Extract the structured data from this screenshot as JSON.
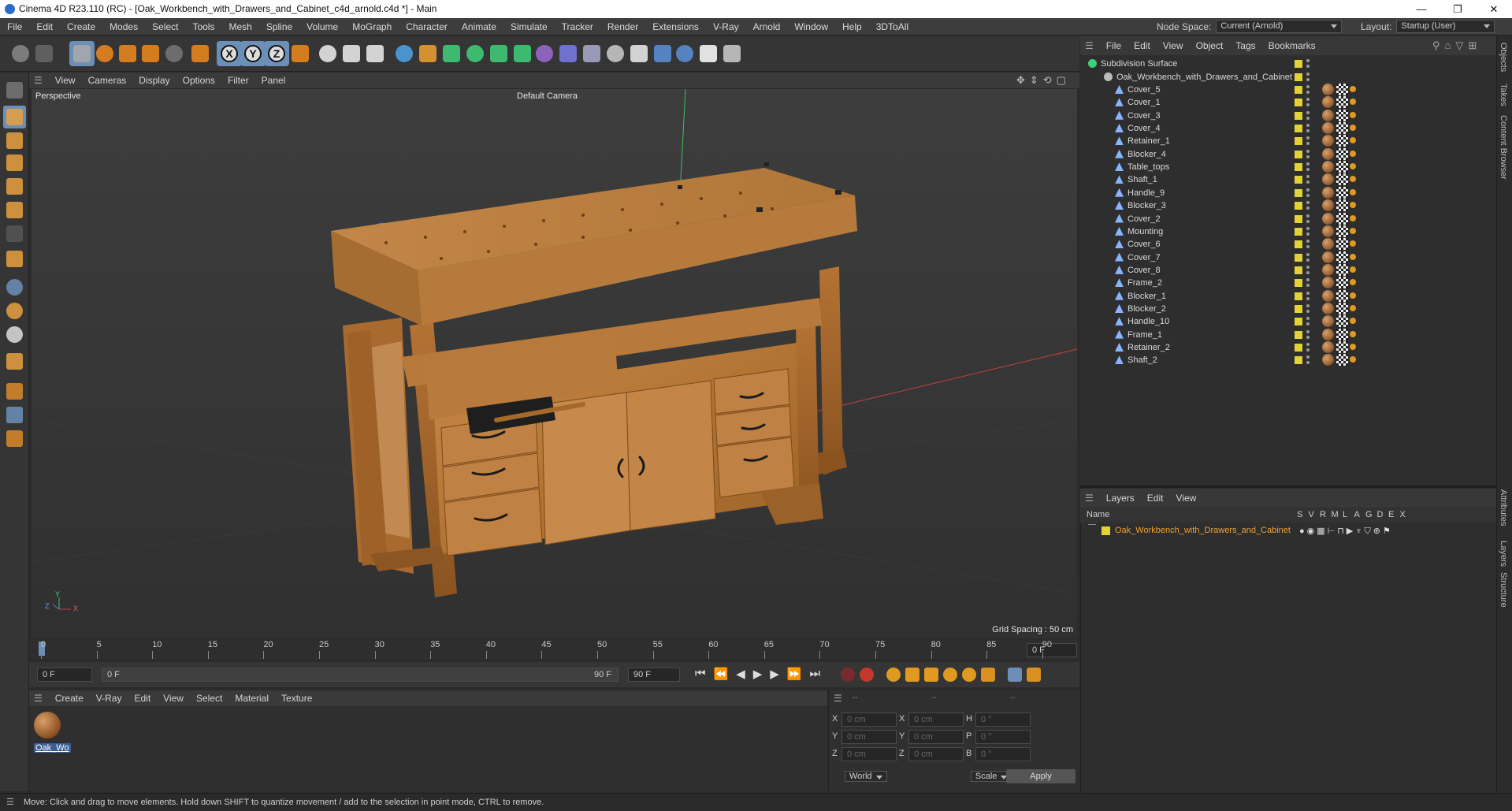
{
  "window": {
    "title": "Cinema 4D R23.110 (RC) - [Oak_Workbench_with_Drawers_and_Cabinet_c4d_arnold.c4d *] - Main",
    "controls": [
      "—",
      "❐",
      "✕"
    ]
  },
  "menubar": {
    "items": [
      "File",
      "Edit",
      "Create",
      "Modes",
      "Select",
      "Tools",
      "Mesh",
      "Spline",
      "Volume",
      "MoGraph",
      "Character",
      "Animate",
      "Simulate",
      "Tracker",
      "Render",
      "Extensions",
      "V-Ray",
      "Arnold",
      "Window",
      "Help",
      "3DToAll"
    ],
    "node_space_label": "Node Space:",
    "node_space_value": "Current (Arnold)",
    "layout_label": "Layout:",
    "layout_value": "Startup (User)"
  },
  "toolbar": {
    "icons": [
      "undo-icon",
      "redo-icon",
      "select-icon",
      "move-icon",
      "scale-icon",
      "rotate-icon",
      "recent-icon",
      "axis-icon",
      "x-axis-icon",
      "y-axis-icon",
      "z-axis-icon",
      "coordinate-system-icon",
      "render-region-icon",
      "render-view-icon",
      "render-settings-icon",
      "cube-icon",
      "pen-icon",
      "subdivision-icon",
      "extrude-icon",
      "cloner-icon",
      "array-icon",
      "symmetry-icon",
      "deformer-icon",
      "floor-icon",
      "camera-icon",
      "light-icon",
      "python-icon",
      "python2-icon",
      "settings-gear-icon",
      "globe-icon"
    ],
    "axis_labels": {
      "x": "X",
      "y": "Y",
      "z": "Z"
    }
  },
  "left_tools": [
    "make-editable-icon",
    "model-mode-icon",
    "texture-mode-icon",
    "points-mode-icon",
    "edges-mode-icon",
    "polygons-mode-icon",
    "uv-mode-icon",
    "l-axis-icon",
    "snap-s1-icon",
    "snap-s2-icon",
    "snap-s3-icon",
    "magnet-icon",
    "grid-icon",
    "workplane-icon",
    "lock-icon"
  ],
  "viewport": {
    "menu": [
      "View",
      "Cameras",
      "Display",
      "Options",
      "Filter",
      "Panel"
    ],
    "mode_label": "Perspective",
    "camera_label": "Default Camera",
    "grid_spacing": "Grid Spacing : 50 cm",
    "axis_x": "X",
    "axis_y": "Y",
    "axis_z": "Z"
  },
  "timeline": {
    "ticks": [
      "0",
      "5",
      "10",
      "15",
      "20",
      "25",
      "30",
      "35",
      "40",
      "45",
      "50",
      "55",
      "60",
      "65",
      "70",
      "75",
      "80",
      "85",
      "90"
    ],
    "current_frame": "0 F"
  },
  "transport": {
    "start_field": "0 F",
    "range_start": "0 F",
    "range_end": "90 F",
    "end_field": "90 F"
  },
  "materials": {
    "menu": [
      "Create",
      "V-Ray",
      "Edit",
      "View",
      "Select",
      "Material",
      "Texture"
    ],
    "items": [
      {
        "name": "Oak_Wo"
      }
    ]
  },
  "coordinates": {
    "headers": [
      "--",
      "--",
      "--"
    ],
    "rows": [
      {
        "a": "X",
        "av": "0 cm",
        "b": "X",
        "bv": "0 cm",
        "c": "H",
        "cv": "0 °"
      },
      {
        "a": "Y",
        "av": "0 cm",
        "b": "Y",
        "bv": "0 cm",
        "c": "P",
        "cv": "0 °"
      },
      {
        "a": "Z",
        "av": "0 cm",
        "b": "Z",
        "bv": "0 cm",
        "c": "B",
        "cv": "0 °"
      }
    ],
    "space": "World",
    "mode": "Scale",
    "apply": "Apply"
  },
  "status": "Move: Click and drag to move elements. Hold down SHIFT to quantize movement / add to the selection in point mode, CTRL to remove.",
  "objects": {
    "menu": [
      "File",
      "Edit",
      "View",
      "Object",
      "Tags",
      "Bookmarks"
    ],
    "root": "Subdivision Surface",
    "group": "Oak_Workbench_with_Drawers_and_Cabinet",
    "children": [
      "Cover_5",
      "Cover_1",
      "Cover_3",
      "Cover_4",
      "Retainer_1",
      "Blocker_4",
      "Table_tops",
      "Shaft_1",
      "Handle_9",
      "Blocker_3",
      "Cover_2",
      "Mounting",
      "Cover_6",
      "Cover_7",
      "Cover_8",
      "Frame_2",
      "Blocker_1",
      "Blocker_2",
      "Handle_10",
      "Frame_1",
      "Retainer_2",
      "Shaft_2"
    ]
  },
  "layers": {
    "menu": [
      "Layers",
      "Edit",
      "View"
    ],
    "name_header": "Name",
    "flags": [
      "S",
      "V",
      "R",
      "M",
      "L",
      "A",
      "G",
      "D",
      "E",
      "X"
    ],
    "items": [
      {
        "name": "Oak_Workbench_with_Drawers_and_Cabinet"
      }
    ]
  },
  "side_tabs": [
    "Objects",
    "Takes",
    "Content Browser",
    "Attributes",
    "Layers",
    "Structure"
  ],
  "colors": {
    "layer_color": "#e3d234",
    "accent_blue": "#6c8fb8",
    "layer_text": "#f0a030"
  }
}
